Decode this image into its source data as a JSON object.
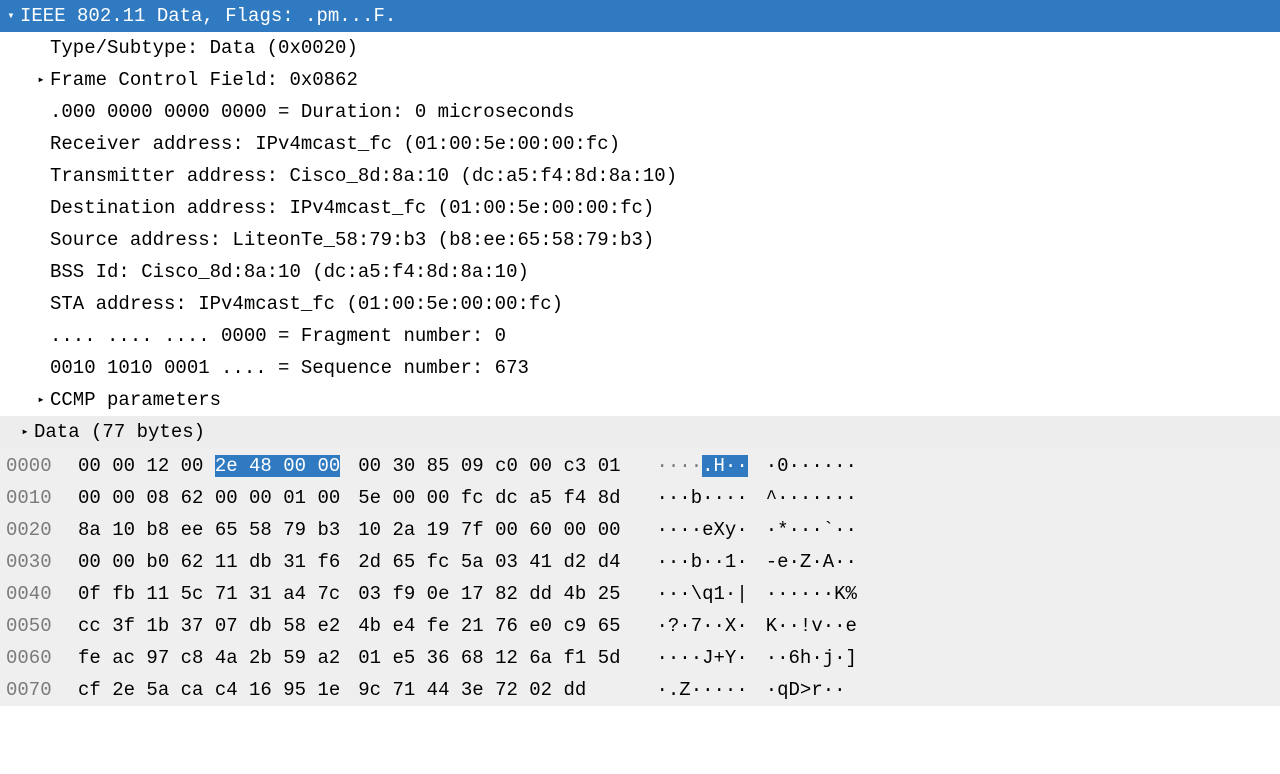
{
  "tree": {
    "header": "IEEE 802.11 Data, Flags: .pm...F.",
    "type_subtype": "Type/Subtype: Data (0x0020)",
    "frame_control": "Frame Control Field: 0x0862",
    "duration": ".000 0000 0000 0000 = Duration: 0 microseconds",
    "receiver": "Receiver address: IPv4mcast_fc (01:00:5e:00:00:fc)",
    "transmitter": "Transmitter address: Cisco_8d:8a:10 (dc:a5:f4:8d:8a:10)",
    "destination": "Destination address: IPv4mcast_fc (01:00:5e:00:00:fc)",
    "source": "Source address: LiteonTe_58:79:b3 (b8:ee:65:58:79:b3)",
    "bssid": "BSS Id: Cisco_8d:8a:10 (dc:a5:f4:8d:8a:10)",
    "sta": "STA address: IPv4mcast_fc (01:00:5e:00:00:fc)",
    "fragment": ".... .... .... 0000 = Fragment number: 0",
    "sequence": "0010 1010 0001 .... = Sequence number: 673",
    "ccmp": "CCMP parameters",
    "data": "Data (77 bytes)"
  },
  "hex": {
    "rows": [
      {
        "offset": "0000",
        "b1a": "00 00 12 00 ",
        "b1hl": "2e 48 00 00",
        "b2": "00 30 85 09 c0 00 c3 01",
        "a1a": "····",
        "a1hl": ".H··",
        "a2": "·0······"
      },
      {
        "offset": "0010",
        "b1": "00 00 08 62 00 00 01 00",
        "b2": "5e 00 00 fc dc a5 f4 8d",
        "a1": "···b····",
        "a2": "^·······"
      },
      {
        "offset": "0020",
        "b1": "8a 10 b8 ee 65 58 79 b3",
        "b2": "10 2a 19 7f 00 60 00 00",
        "a1": "····eXy·",
        "a2": "·*···`··"
      },
      {
        "offset": "0030",
        "b1": "00 00 b0 62 11 db 31 f6",
        "b2": "2d 65 fc 5a 03 41 d2 d4",
        "a1": "···b··1·",
        "a2": "-e·Z·A··"
      },
      {
        "offset": "0040",
        "b1": "0f fb 11 5c 71 31 a4 7c",
        "b2": "03 f9 0e 17 82 dd 4b 25",
        "a1": "···\\q1·|",
        "a2": "······K%"
      },
      {
        "offset": "0050",
        "b1": "cc 3f 1b 37 07 db 58 e2",
        "b2": "4b e4 fe 21 76 e0 c9 65",
        "a1": "·?·7··X·",
        "a2": "K··!v··e"
      },
      {
        "offset": "0060",
        "b1": "fe ac 97 c8 4a 2b 59 a2",
        "b2": "01 e5 36 68 12 6a f1 5d",
        "a1": "····J+Y·",
        "a2": "··6h·j·]"
      },
      {
        "offset": "0070",
        "b1": "cf 2e 5a ca c4 16 95 1e",
        "b2": "9c 71 44 3e 72 02 dd   ",
        "a1": "·.Z·····",
        "a2": "·qD>r·· "
      }
    ]
  }
}
